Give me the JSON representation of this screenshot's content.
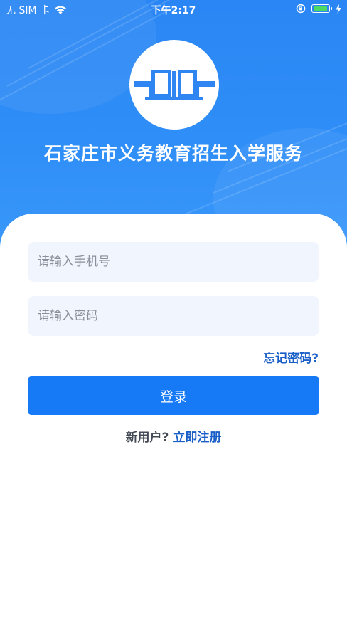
{
  "status_bar": {
    "carrier": "无 SIM 卡",
    "time": "下午2:17",
    "battery_color": "#4cd964"
  },
  "app": {
    "title": "石家庄市义务教育招生入学服务",
    "logo_icon": "open-book-icon",
    "brand_color": "#1679f5"
  },
  "form": {
    "phone_placeholder": "请输入手机号",
    "password_placeholder": "请输入密码",
    "forgot_password": "忘记密码?",
    "login_button": "登录"
  },
  "register": {
    "prompt": "新用户?",
    "link": "立即注册"
  }
}
